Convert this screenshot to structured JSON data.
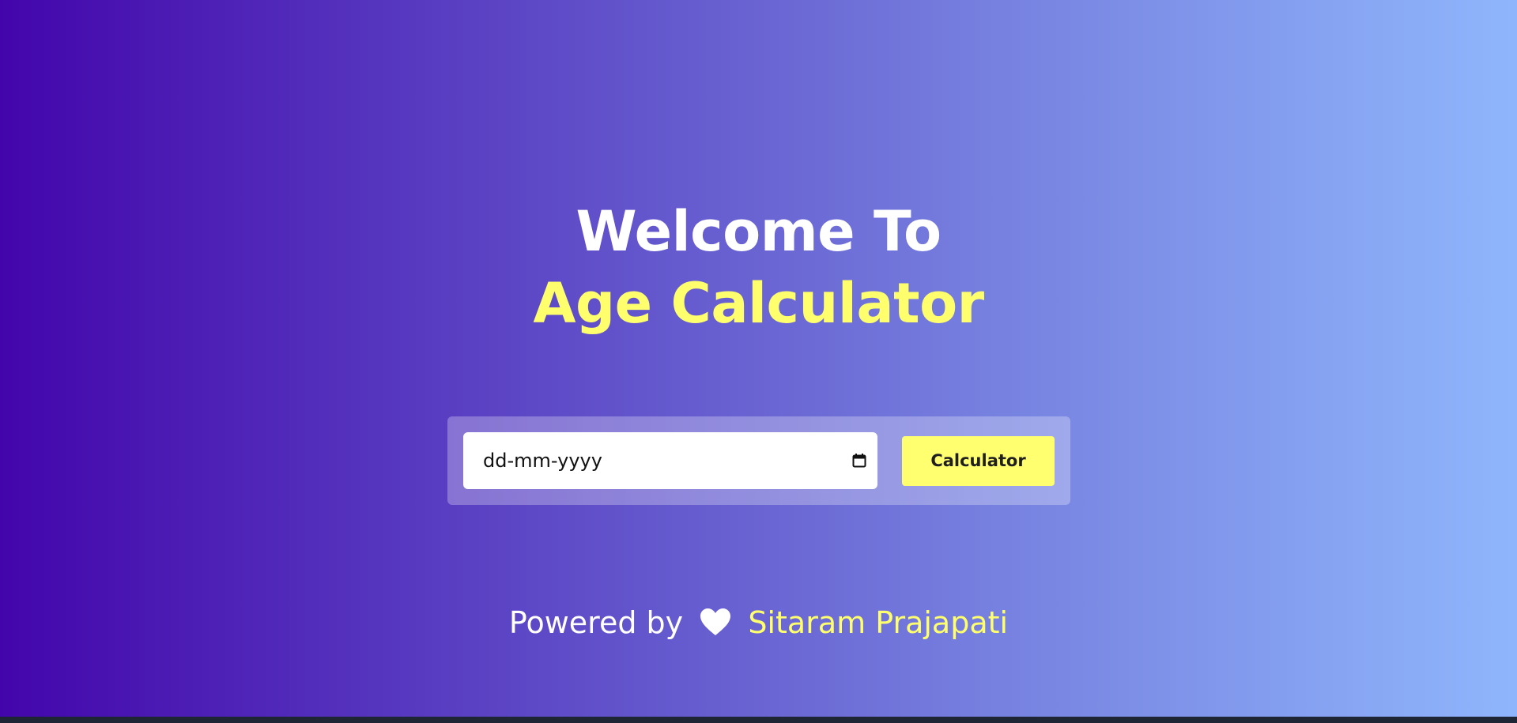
{
  "heading": {
    "line1": "Welcome To",
    "line2": "Age Calculator"
  },
  "form": {
    "date_placeholder": "dd-mm-yyyy",
    "calendar_icon": "calendar-icon",
    "button_label": "Calculator"
  },
  "footer": {
    "prefix": "Powered by",
    "heart_icon": "heart-icon",
    "author": "Sitaram Prajapati"
  },
  "colors": {
    "accent_yellow": "#ffff6e",
    "button_bg": "#ffff70",
    "gradient_start": "#4305ab",
    "gradient_end": "#8fb6fc"
  }
}
